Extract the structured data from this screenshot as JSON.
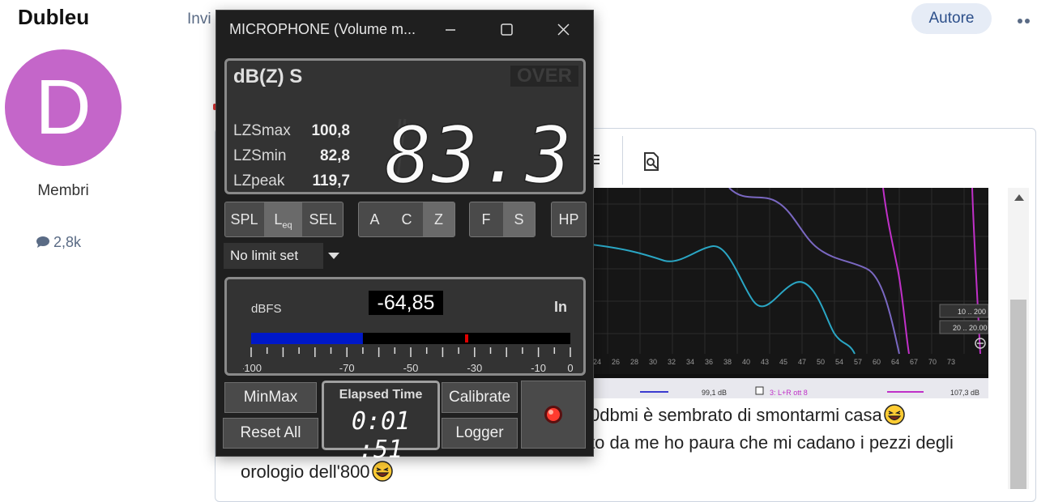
{
  "forum": {
    "username": "Dubleu",
    "avatar_letter": "D",
    "role": "Membri",
    "post_count": "2,8k",
    "partial_tab": "Invi",
    "author_badge": "Autore",
    "post_lines": [
      "0dbmi è sembrato di smontarmi casa",
      "to da me ho paura che mi cadano i pezzi degli",
      "orologio dell'800"
    ],
    "avatar_color": "#c466c9"
  },
  "graph": {
    "x_ticks": [
      "24",
      "26",
      "28",
      "30",
      "32",
      "34",
      "36",
      "38",
      "40",
      "43",
      "45",
      "47",
      "50",
      "54",
      "57",
      "60",
      "64",
      "67",
      "70",
      "73"
    ],
    "legend": [
      "99,1 dB",
      "3: L+R ott 8",
      "107,3 dB"
    ],
    "side_labels": [
      "10 .. 200",
      "20 .. 20.00"
    ]
  },
  "meter": {
    "title": "MICROPHONE (Volume m...",
    "display_title": "dB(Z) S",
    "over_label": "OVER",
    "reading": "83.3",
    "stats": [
      {
        "label": "LZSmax",
        "value": "100,8"
      },
      {
        "label": "LZSmin",
        "value": "82,8"
      },
      {
        "label": "LZpeak",
        "value": "119,7"
      }
    ],
    "mode_buttons": [
      "SPL",
      "L",
      "eq",
      "SEL"
    ],
    "weight_buttons": [
      "A",
      "C",
      "Z"
    ],
    "time_buttons": [
      "F",
      "S"
    ],
    "hp_button": "HP",
    "limit_select": "No limit set",
    "dbfs_label": "dBFS",
    "dbfs_value": "-64,85",
    "input_label": "In",
    "level_fraction": 0.35,
    "peak_fraction": 0.67,
    "scale_labels": [
      "-100",
      "-70",
      "-50",
      "-30",
      "-10",
      "0"
    ],
    "minmax": "MinMax",
    "reset_all": "Reset All",
    "elapsed_label": "Elapsed Time",
    "elapsed_value": "0:01 :51",
    "calibrate": "Calibrate",
    "logger": "Logger",
    "colors": {
      "bar": "#0018c8",
      "peak": "#e00000",
      "record": "#ff3b2f"
    }
  }
}
